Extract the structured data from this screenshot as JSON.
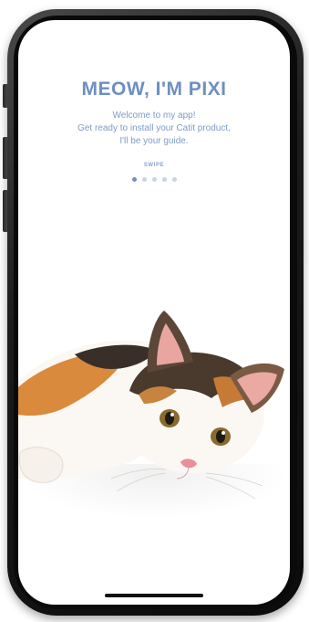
{
  "onboarding": {
    "title": "MEOW, I'M PIXI",
    "subtitle_lines": [
      "Welcome to my app!",
      "Get ready to install your Catit product,",
      "I'll be your guide."
    ],
    "swipe_label": "SWIPE",
    "pager": {
      "total": 5,
      "active_index": 0
    }
  },
  "colors": {
    "accent": "#6e8fc1",
    "dot_inactive": "#c9d3e3",
    "background": "#ffffff"
  },
  "images": {
    "hero": "calico-kitten-lying-down"
  }
}
